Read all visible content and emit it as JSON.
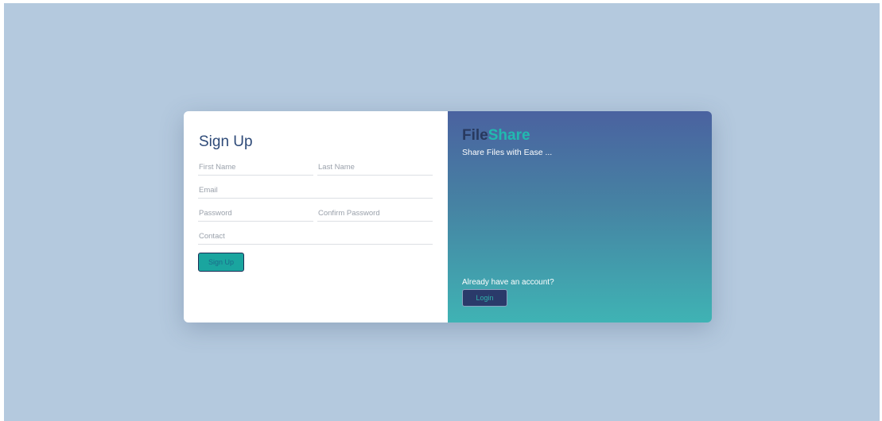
{
  "signup": {
    "title": "Sign Up",
    "fields": {
      "first_name": "First Name",
      "last_name": "Last Name",
      "email": "Email",
      "password": "Password",
      "confirm_password": "Confirm Password",
      "contact": "Contact"
    },
    "button_label": "Sign Up"
  },
  "promo": {
    "brand_part1": "File",
    "brand_part2": "Share",
    "tagline": "Share Files with Ease ...",
    "prompt": "Already have an account?",
    "login_label": "Login"
  },
  "colors": {
    "background": "#b4c9de",
    "accent": "#1aa59f",
    "brand_dark": "#28395e",
    "brand_teal": "#21bab0",
    "gradient_top": "#4a62a0",
    "gradient_bottom": "#3fb3b4"
  }
}
